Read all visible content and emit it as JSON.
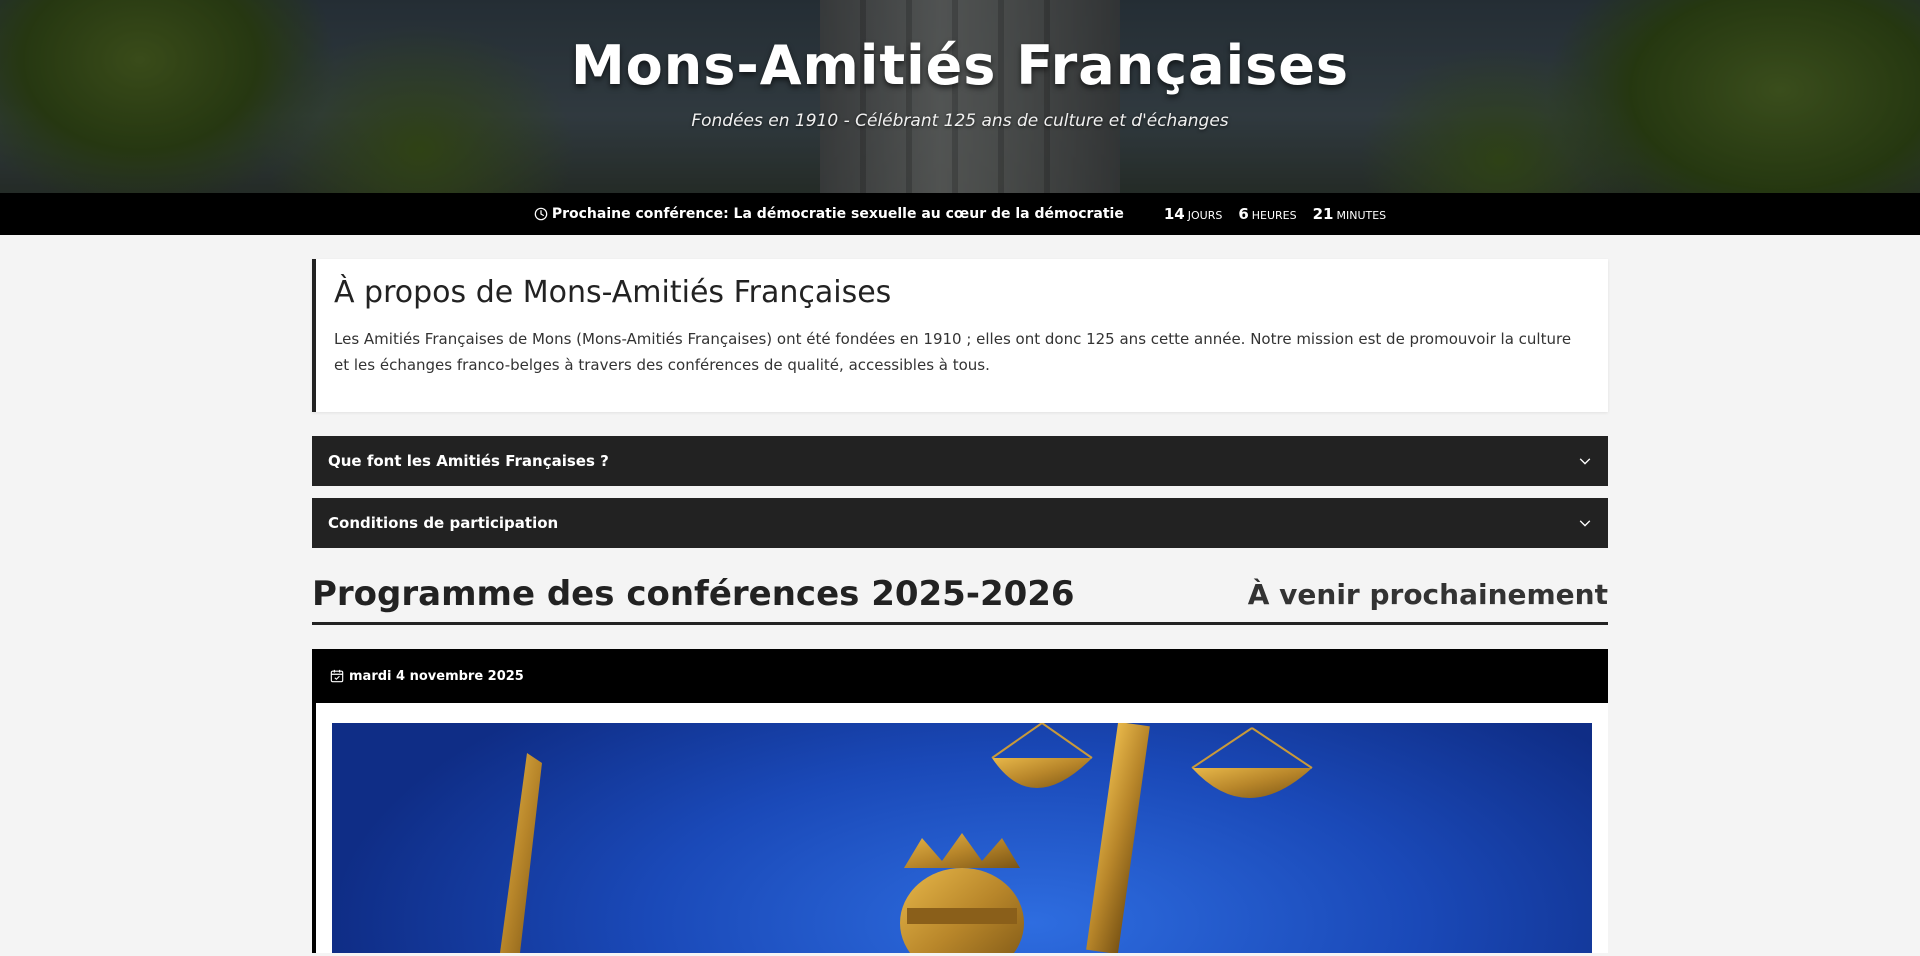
{
  "hero": {
    "title": "Mons-Amitiés Françaises",
    "subtitle": "Fondées en 1910 - Célébrant 125 ans de culture et d'échanges"
  },
  "countdown": {
    "icon": "clock-icon",
    "label": "Prochaine conférence: La démocratie sexuelle au cœur de la démocratie",
    "days": "14",
    "days_label": "JOURS",
    "hours": "6",
    "hours_label": "HEURES",
    "minutes": "21",
    "minutes_label": "MINUTES"
  },
  "about": {
    "title": "À propos de Mons-Amitiés Françaises",
    "text": "Les Amitiés Françaises de Mons (Mons-Amitiés Françaises) ont été fondées en 1910 ; elles ont donc 125 ans cette année. Notre mission est de promouvoir la culture et les échanges franco-belges à travers des conférences de qualité, accessibles à tous."
  },
  "accordions": [
    {
      "label": "Que font les Amitiés Françaises ?"
    },
    {
      "label": "Conditions de participation"
    }
  ],
  "program": {
    "title": "Programme des conférences 2025-2026",
    "upcoming": "À venir prochainement"
  },
  "event": {
    "date": "mardi 4 novembre 2025",
    "icon": "calendar-icon"
  },
  "colors": {
    "dark": "#222222",
    "black": "#000000",
    "background": "#f4f4f4",
    "image_blue": "#1a49b8"
  }
}
